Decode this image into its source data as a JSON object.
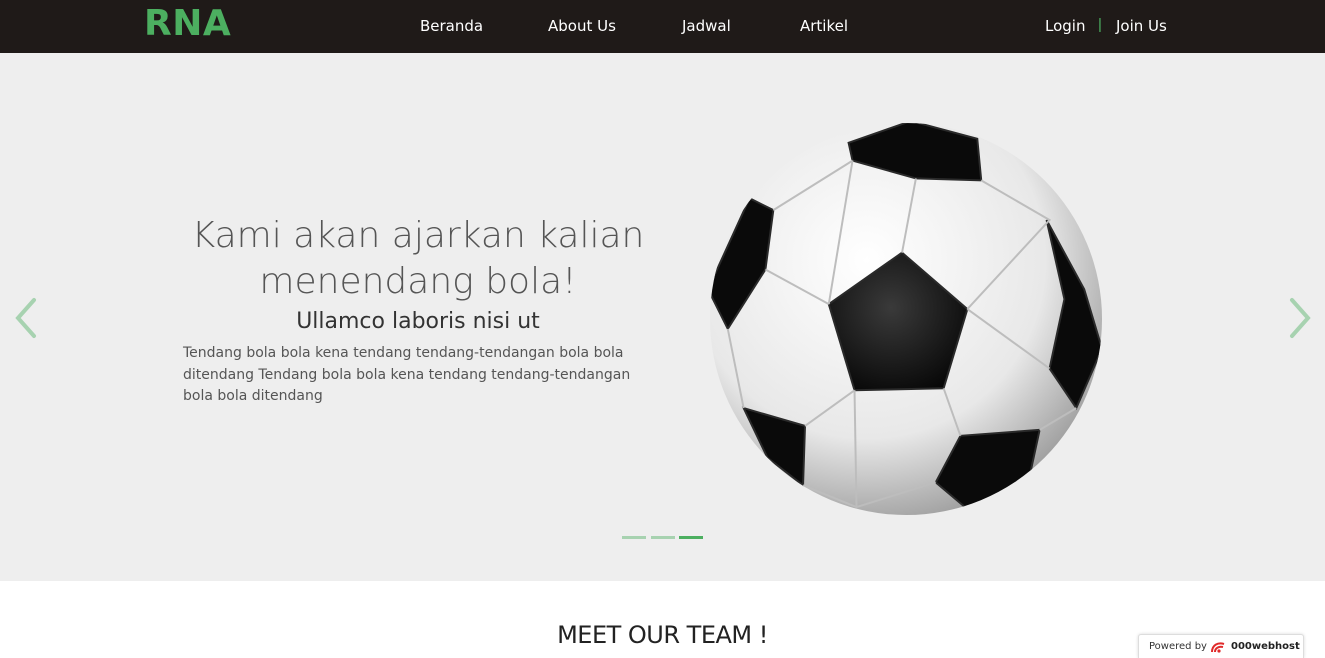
{
  "navbar": {
    "brand": "RNA",
    "links": [
      "Beranda",
      "About Us",
      "Jadwal",
      "Artikel"
    ],
    "login": "Login",
    "separator": "|",
    "join": "Join Us"
  },
  "carousel": {
    "headline_line1": "Kami akan ajarkan kalian",
    "headline_line2": "menendang bola!",
    "subhead": "Ullamco laboris nisi ut",
    "body": "Tendang bola bola kena tendang tendang-tendangan bola bola ditendang Tendang bola bola kena tendang tendang-tendangan bola bola ditendang",
    "active_slide": 3,
    "slide_count": 3,
    "image": "soccer-ball"
  },
  "team": {
    "title": "MEET OUR TEAM !"
  },
  "badge": {
    "powered_by": "Powered by",
    "host": "000webhost"
  },
  "colors": {
    "navbar_bg": "#1f1a18",
    "accent": "#4caf60",
    "carousel_bg": "#eeeeee",
    "arrow": "#a7d2b0"
  }
}
